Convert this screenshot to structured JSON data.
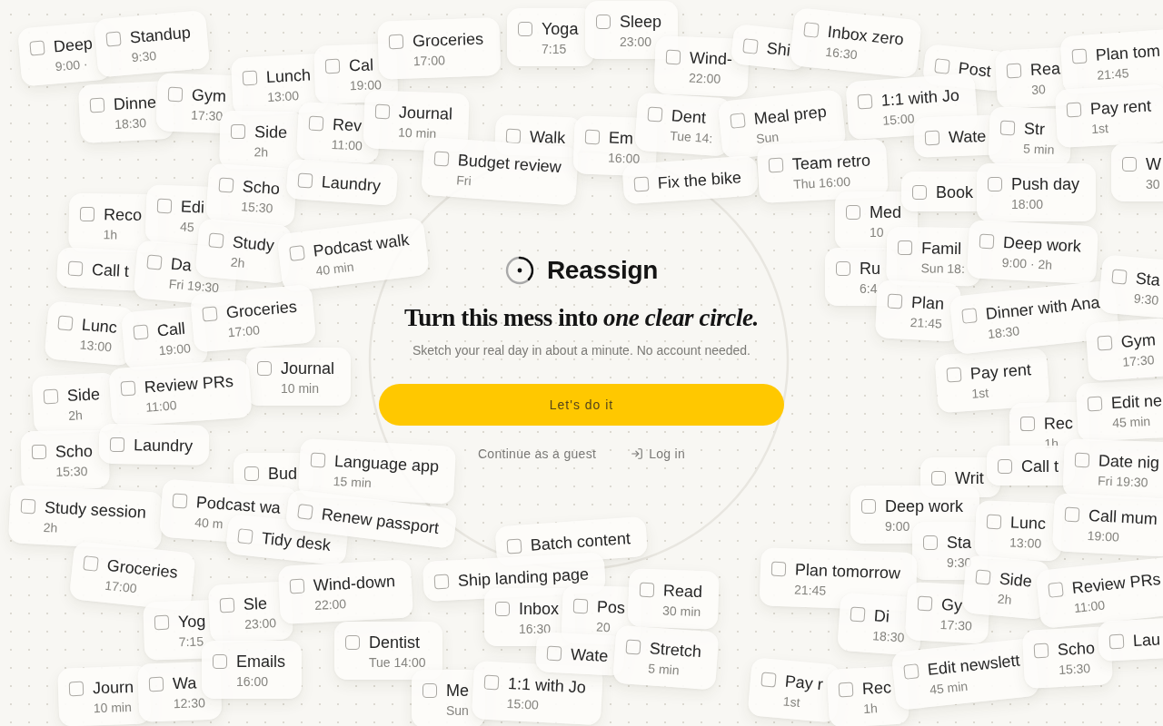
{
  "brand": {
    "name": "Reassign"
  },
  "headline": "Turn this mess into *one clear circle.*",
  "subheadline": "Sketch your real day in about a minute. No account needed.",
  "primary_button": "Let's do it",
  "links": [
    {
      "kind": "text",
      "label": "Continue as a guest"
    },
    {
      "kind": "login",
      "label": "Log in"
    }
  ],
  "task_cards": [
    {
      "title": "Deep",
      "subtitle": "9:00 ·",
      "checked": false
    },
    {
      "title": "Standup",
      "subtitle": "9:30",
      "checked": false
    },
    {
      "title": "Dinne",
      "subtitle": "18:30",
      "checked": false
    },
    {
      "title": "Gym",
      "subtitle": "17:30",
      "checked": false
    },
    {
      "title": "Lunch",
      "subtitle": "13:00",
      "checked": false
    },
    {
      "title": "Cal",
      "subtitle": "19:00",
      "checked": false
    },
    {
      "title": "Groceries",
      "subtitle": "17:00",
      "checked": false
    },
    {
      "title": "Side",
      "subtitle": "2h",
      "checked": false
    },
    {
      "title": "Rev",
      "subtitle": "11:00",
      "checked": false
    },
    {
      "title": "Journal",
      "subtitle": "10 min",
      "checked": false
    },
    {
      "title": "Reco",
      "subtitle": "1h",
      "checked": false
    },
    {
      "title": "Edi",
      "subtitle": "45",
      "checked": false
    },
    {
      "title": "Scho",
      "subtitle": "15:30",
      "checked": false
    },
    {
      "title": "Laundry",
      "checked": false
    },
    {
      "title": "Call t",
      "checked": false
    },
    {
      "title": "Da",
      "subtitle": "Fri 19:30",
      "checked": false
    },
    {
      "title": "Study",
      "subtitle": "2h",
      "checked": false
    },
    {
      "title": "Podcast walk",
      "subtitle": "40 min",
      "checked": false
    },
    {
      "title": "Lunc",
      "subtitle": "13:00",
      "checked": false
    },
    {
      "title": "Call",
      "subtitle": "19:00",
      "checked": false
    },
    {
      "title": "Groceries",
      "subtitle": "17:00",
      "checked": false
    },
    {
      "title": "Journal",
      "subtitle": "10 min",
      "checked": false
    },
    {
      "title": "Side",
      "subtitle": "2h",
      "checked": false
    },
    {
      "title": "Review PRs",
      "subtitle": "11:00",
      "checked": false
    },
    {
      "title": "Scho",
      "subtitle": "15:30",
      "checked": false
    },
    {
      "title": "Laundry",
      "checked": false
    },
    {
      "title": "Study session",
      "subtitle": "2h",
      "checked": false
    },
    {
      "title": "Bud",
      "checked": false
    },
    {
      "title": "Language app",
      "subtitle": "15 min",
      "checked": false
    },
    {
      "title": "Podcast wa",
      "subtitle": "40 m",
      "checked": false
    },
    {
      "title": "Tidy desk",
      "checked": false
    },
    {
      "title": "Renew passport",
      "checked": false
    },
    {
      "title": "Groceries",
      "subtitle": "17:00",
      "checked": false
    },
    {
      "title": "Yog",
      "subtitle": "7:15",
      "checked": false
    },
    {
      "title": "Sle",
      "subtitle": "23:00",
      "checked": false
    },
    {
      "title": "Wind-down",
      "subtitle": "22:00",
      "checked": false
    },
    {
      "title": "Dentist",
      "subtitle": "Tue 14:00",
      "checked": false
    },
    {
      "title": "Journ",
      "subtitle": "10 min",
      "checked": false
    },
    {
      "title": "Wa",
      "subtitle": "12:30",
      "checked": false
    },
    {
      "title": "Emails",
      "subtitle": "16:00",
      "checked": false
    },
    {
      "title": "Batch content",
      "checked": false
    },
    {
      "title": "Ship landing page",
      "checked": false
    },
    {
      "title": "Inbox",
      "subtitle": "16:30",
      "checked": false
    },
    {
      "title": "Pos",
      "subtitle": "20",
      "checked": false
    },
    {
      "title": "Read",
      "subtitle": "30 min",
      "checked": false
    },
    {
      "title": "Me",
      "subtitle": "Sun",
      "checked": false
    },
    {
      "title": "1:1 with Jo",
      "subtitle": "15:00",
      "checked": false
    },
    {
      "title": "Wate",
      "checked": false
    },
    {
      "title": "Stretch",
      "subtitle": "5 min",
      "checked": false
    },
    {
      "title": "Pay rent",
      "subtitle": "1st",
      "checked": false
    },
    {
      "title": "Rec",
      "subtitle": "1h",
      "checked": false
    },
    {
      "title": "Edit ne",
      "subtitle": "45 min",
      "checked": false
    },
    {
      "title": "Writ",
      "checked": false
    },
    {
      "title": "Call t",
      "checked": false
    },
    {
      "title": "Date nig",
      "subtitle": "Fri 19:30",
      "checked": false
    },
    {
      "title": "Deep work",
      "subtitle": "9:00",
      "checked": false
    },
    {
      "title": "Sta",
      "subtitle": "9:30",
      "checked": false
    },
    {
      "title": "Lunc",
      "subtitle": "13:00",
      "checked": false
    },
    {
      "title": "Call mum",
      "subtitle": "19:00",
      "checked": false
    },
    {
      "title": "Plan tomorrow",
      "subtitle": "21:45",
      "checked": false
    },
    {
      "title": "Di",
      "subtitle": "18:30",
      "checked": false
    },
    {
      "title": "Gy",
      "subtitle": "17:30",
      "checked": false
    },
    {
      "title": "Side",
      "subtitle": "2h",
      "checked": false
    },
    {
      "title": "Review PRs",
      "subtitle": "11:00",
      "checked": false
    },
    {
      "title": "Pay r",
      "subtitle": "1st",
      "checked": false
    },
    {
      "title": "Rec",
      "subtitle": "1h",
      "checked": false
    },
    {
      "title": "Edit newslett",
      "subtitle": "45 min",
      "checked": false
    },
    {
      "title": "Scho",
      "subtitle": "15:30",
      "checked": false
    },
    {
      "title": "Lau",
      "checked": false
    },
    {
      "title": "Yoga",
      "subtitle": "7:15",
      "checked": false
    },
    {
      "title": "Sleep",
      "subtitle": "23:00",
      "checked": false
    },
    {
      "title": "Wind-",
      "subtitle": "22:00",
      "checked": false
    },
    {
      "title": "Shi",
      "checked": false
    },
    {
      "title": "Inbox zero",
      "subtitle": "16:30",
      "checked": false
    },
    {
      "title": "Walk",
      "checked": false
    },
    {
      "title": "Budget review",
      "subtitle": "Fri",
      "checked": false
    },
    {
      "title": "Em",
      "subtitle": "16:00",
      "checked": false
    },
    {
      "title": "Dent",
      "subtitle": "Tue 14:",
      "checked": false
    },
    {
      "title": "Meal prep",
      "subtitle": "Sun",
      "checked": false
    },
    {
      "title": "Fix the bike",
      "checked": false
    },
    {
      "title": "Post",
      "checked": false
    },
    {
      "title": "Rea",
      "subtitle": "30",
      "checked": false
    },
    {
      "title": "Plan tom",
      "subtitle": "21:45",
      "checked": false
    },
    {
      "title": "1:1 with Jo",
      "subtitle": "15:00",
      "checked": false
    },
    {
      "title": "Wate",
      "checked": false
    },
    {
      "title": "Str",
      "subtitle": "5 min",
      "checked": false
    },
    {
      "title": "Pay rent",
      "subtitle": "1st",
      "checked": false
    },
    {
      "title": "Team retro",
      "subtitle": "Thu 16:00",
      "checked": false
    },
    {
      "title": "W",
      "subtitle": "30",
      "checked": false
    },
    {
      "title": "Med",
      "subtitle": "10",
      "checked": false
    },
    {
      "title": "Book",
      "checked": false
    },
    {
      "title": "Push day",
      "subtitle": "18:00",
      "checked": false
    },
    {
      "title": "Ru",
      "subtitle": "6:4",
      "checked": false
    },
    {
      "title": "Famil",
      "subtitle": "Sun 18:",
      "checked": false
    },
    {
      "title": "Deep work",
      "subtitle": "9:00 · 2h",
      "checked": false
    },
    {
      "title": "Plan",
      "subtitle": "21:45",
      "checked": false
    },
    {
      "title": "Dinner with Ana",
      "subtitle": "18:30",
      "checked": false
    },
    {
      "title": "Sta",
      "subtitle": "9:30",
      "checked": false
    },
    {
      "title": "Gym",
      "subtitle": "17:30",
      "checked": false
    }
  ]
}
